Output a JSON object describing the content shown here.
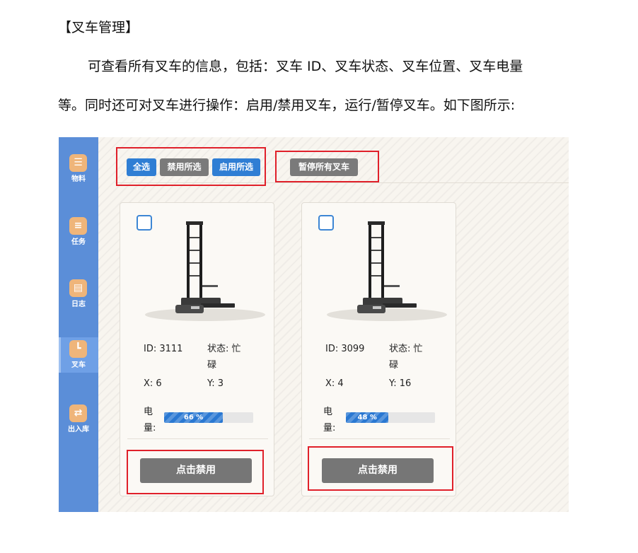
{
  "document": {
    "heading": "【叉车管理】",
    "paragraph_line1": "可查看所有叉车的信息，包括：叉车 ID、叉车状态、叉车位置、叉车电量",
    "paragraph_line2": "等。同时还可对叉车进行操作：启用/禁用叉车，运行/暂停叉车。如下图所示:"
  },
  "sidebar": {
    "items": [
      {
        "label": "物料",
        "icon": "list-icon",
        "glyph": "☰"
      },
      {
        "label": "任务",
        "icon": "tasks-icon",
        "glyph": "≡"
      },
      {
        "label": "日志",
        "icon": "document-icon",
        "glyph": "▤"
      },
      {
        "label": "叉车",
        "icon": "forklift-icon",
        "glyph": "┗",
        "active": true
      },
      {
        "label": "出入库",
        "icon": "swap-icon",
        "glyph": "⇄"
      }
    ]
  },
  "toolbar": {
    "select_all": "全选",
    "disable_selected": "禁用所选",
    "enable_selected": "启用所选",
    "pause_all": "暂停所有叉车"
  },
  "forklifts": [
    {
      "id_text": "ID: 3111",
      "status_line1": "状态: 忙",
      "status_line2": "碌",
      "x_text": "X: 6",
      "y_text": "Y: 3",
      "battery_label_line1": "电",
      "battery_label_line2": "量:",
      "battery_percent": 66,
      "battery_text": "66 %",
      "action_label": "点击禁用"
    },
    {
      "id_text": "ID: 3099",
      "status_line1": "状态: 忙",
      "status_line2": "碌",
      "x_text": "X: 4",
      "y_text": "Y: 16",
      "battery_label_line1": "电",
      "battery_label_line2": "量:",
      "battery_percent": 48,
      "battery_text": "48 %",
      "action_label": "点击禁用"
    }
  ],
  "colors": {
    "sidebar": "#5b8ed8",
    "primary_button": "#2f7ed4",
    "secondary_button": "#7a7a7a",
    "highlight_box": "#e0202a",
    "battery_fill": "#2a78d2",
    "icon_badge": "#efb57a"
  }
}
